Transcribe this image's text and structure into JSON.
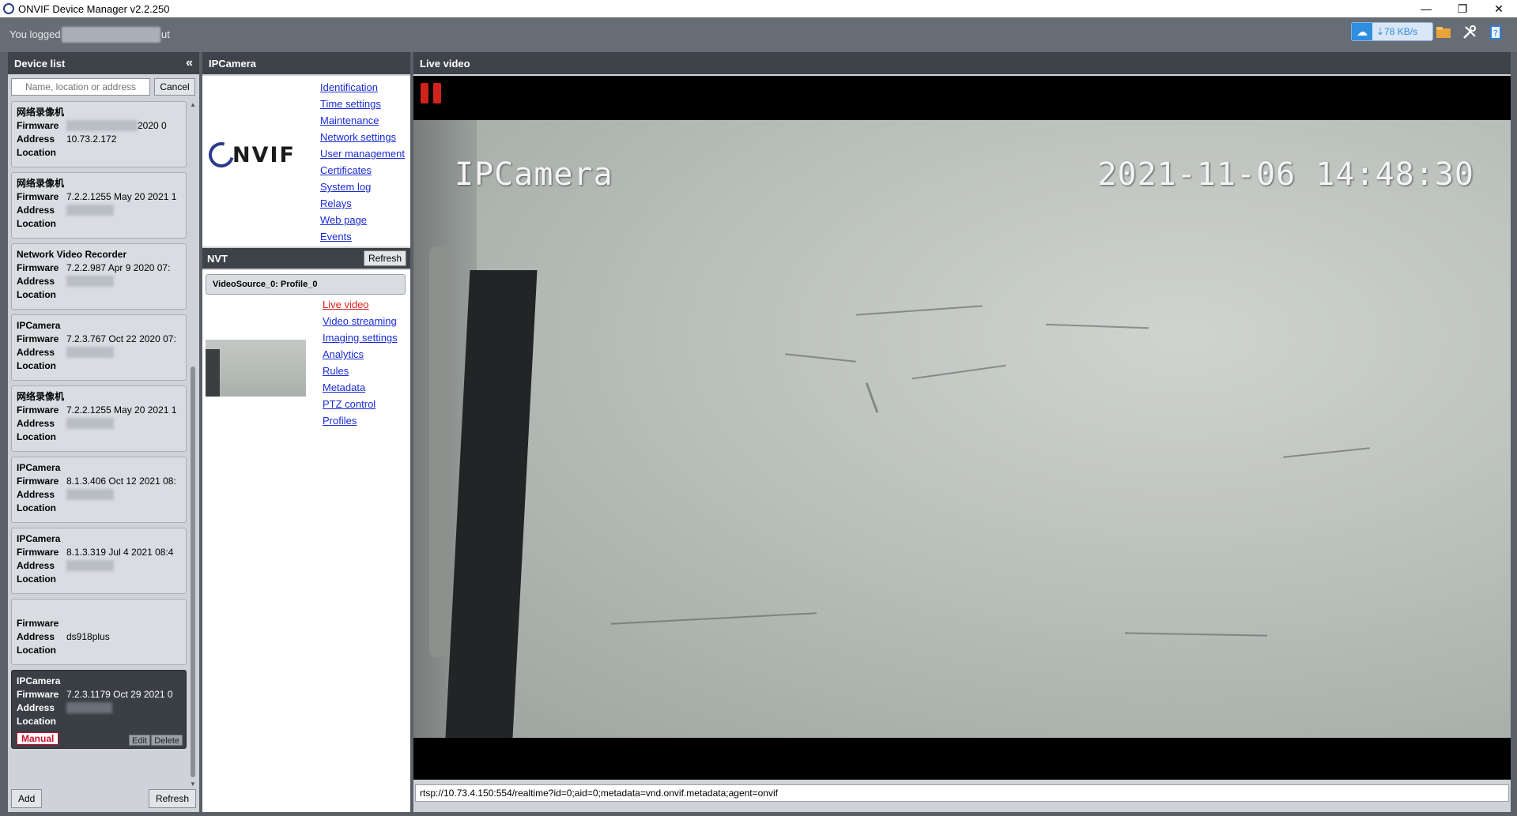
{
  "window": {
    "title": "ONVIF Device Manager v2.2.250",
    "minimize": "—",
    "restore": "❐",
    "close": "✕"
  },
  "topbar": {
    "logged_prefix": "You logged",
    "logged_suffix": "ut",
    "net_speed": "⇣78 KB/s",
    "cloud_icon": "☁"
  },
  "device_list": {
    "title": "Device list",
    "collapse": "«",
    "search_placeholder": "Name, location or address",
    "cancel": "Cancel",
    "labels": {
      "firmware": "Firmware",
      "address": "Address",
      "location": "Location"
    },
    "devices": [
      {
        "name": "网络录像机",
        "firmware": "2020 0",
        "address": "10.73.2.172",
        "location": ""
      },
      {
        "name": "网络录像机",
        "firmware": "7.2.2.1255 May 20 2021 1",
        "address": "",
        "location": ""
      },
      {
        "name": "Network Video Recorder",
        "firmware": "7.2.2.987 Apr  9 2020 07:",
        "address": "",
        "location": ""
      },
      {
        "name": "IPCamera",
        "firmware": "7.2.3.767 Oct 22 2020 07:",
        "address": "",
        "location": ""
      },
      {
        "name": "网络录像机",
        "firmware": "7.2.2.1255 May 20 2021 1",
        "address": "",
        "location": ""
      },
      {
        "name": "IPCamera",
        "firmware": "8.1.3.406 Oct 12 2021 08:",
        "address": "",
        "location": ""
      },
      {
        "name": "IPCamera",
        "firmware": "8.1.3.319 Jul  4 2021 08:4",
        "address": "",
        "location": ""
      },
      {
        "name": "",
        "firmware": "",
        "address": "ds918plus",
        "location": ""
      }
    ],
    "selected_device": {
      "name": "IPCamera",
      "firmware": "7.2.3.1179 Oct 29 2021 0",
      "address": "",
      "location": "",
      "manual_badge": "Manual",
      "edit": "Edit",
      "delete": "Delete"
    },
    "add": "Add",
    "refresh": "Refresh"
  },
  "camera_panel": {
    "title": "IPCamera",
    "logo_text": "NVIF",
    "links": [
      "Identification",
      "Time settings",
      "Maintenance",
      "Network settings",
      "User management",
      "Certificates",
      "System log",
      "Relays",
      "Web page",
      "Events"
    ],
    "nvt_title": "NVT",
    "nvt_refresh": "Refresh",
    "profile_tab": "VideoSource_0: Profile_0",
    "nvt_links": [
      "Live video",
      "Video streaming",
      "Imaging settings",
      "Analytics",
      "Rules",
      "Metadata",
      "PTZ control",
      "Profiles"
    ],
    "active_link": "Live video"
  },
  "live_video": {
    "title": "Live video",
    "osd_name": "IPCamera",
    "osd_time": "2021-11-06 14:48:30",
    "stream_url": "rtsp://10.73.4.150:554/realtime?id=0;aid=0;metadata=vnd.onvif.metadata;agent=onvif"
  },
  "colors": {
    "link": "#1a2bd6",
    "active_link": "#e0201a",
    "header_bg": "#3e4349",
    "pause": "#d0231b"
  }
}
